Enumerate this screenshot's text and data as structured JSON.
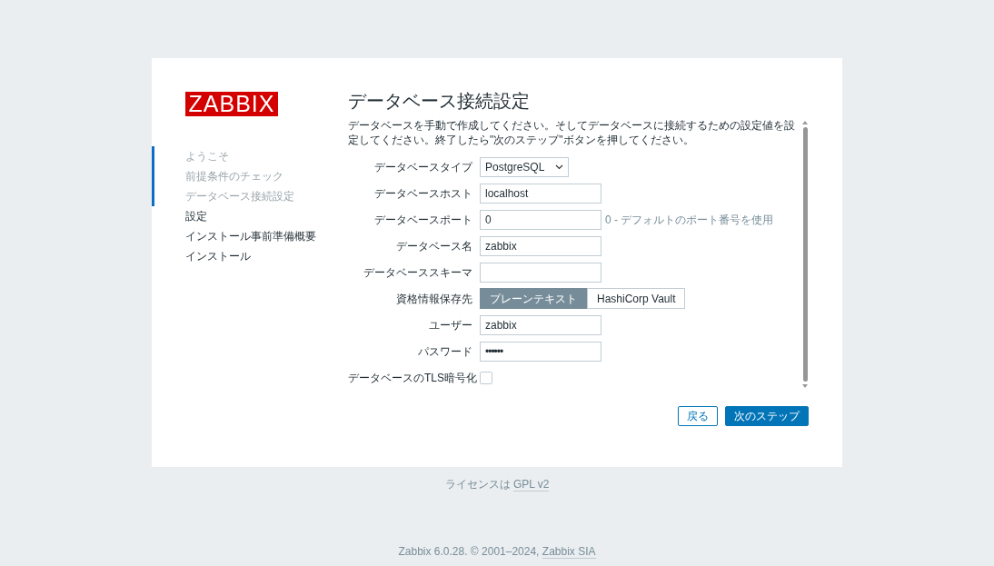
{
  "logo": "ZABBIX",
  "steps": [
    {
      "label": "ようこそ",
      "completed": true
    },
    {
      "label": "前提条件のチェック",
      "completed": true
    },
    {
      "label": "データベース接続設定",
      "completed": true
    },
    {
      "label": "設定",
      "completed": false
    },
    {
      "label": "インストール事前準備概要",
      "completed": false
    },
    {
      "label": "インストール",
      "completed": false
    }
  ],
  "title": "データベース接続設定",
  "intro": "データベースを手動で作成してください。そしてデータベースに接続するための設定値を設定してください。終了したら\"次のステップ\"ボタンを押してください。",
  "fields": [
    {
      "kind": "select",
      "label": "データベースタイプ",
      "value": "PostgreSQL"
    },
    {
      "kind": "text",
      "label": "データベースホスト",
      "value": "localhost"
    },
    {
      "kind": "text",
      "label": "データベースポート",
      "value": "0",
      "hint": "0 - デフォルトのポート番号を使用"
    },
    {
      "kind": "text",
      "label": "データベース名",
      "value": "zabbix"
    },
    {
      "kind": "text",
      "label": "データベーススキーマ"
    },
    {
      "kind": "toggle",
      "label": "資格情報保存先",
      "options": [
        {
          "label": "プレーンテキスト",
          "selected": true
        },
        {
          "label": "HashiCorp Vault",
          "selected": false
        }
      ]
    },
    {
      "kind": "text",
      "label": "ユーザー",
      "value": "zabbix"
    },
    {
      "kind": "password",
      "label": "パスワード",
      "value": "••••••"
    },
    {
      "kind": "checkbox",
      "label": "データベースのTLS暗号化",
      "checked": false
    }
  ],
  "buttons": [
    {
      "label": "戻る",
      "kind": "secondary"
    },
    {
      "label": "次のステップ",
      "kind": "primary"
    }
  ],
  "license": {
    "text": "ライセンスは",
    "link": "GPL v2"
  },
  "copyright": {
    "text": "Zabbix 6.0.28. © 2001–2024,",
    "link": "Zabbix SIA"
  }
}
